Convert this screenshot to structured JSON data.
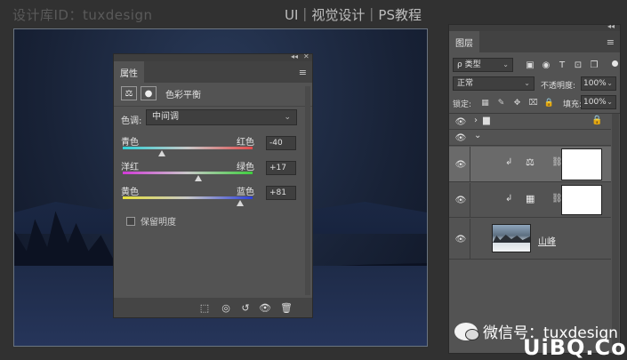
{
  "header": {
    "watermark_left": "设计库ID：tuxdesign",
    "watermark_center": "UI｜视觉设计｜PS教程"
  },
  "properties": {
    "tab_label": "属性",
    "topstrip_left": "◂◂",
    "topstrip_right": "✕",
    "menu": "≡",
    "adjustment_icon": "⚖",
    "mask_icon": "●",
    "title": "色彩平衡",
    "tone_label": "色调:",
    "tone_value": "中间调",
    "sliders": [
      {
        "left": "青色",
        "right": "红色",
        "value": "-40",
        "level": -40
      },
      {
        "left": "洋红",
        "right": "绿色",
        "value": "+17",
        "level": 17
      },
      {
        "left": "黄色",
        "right": "蓝色",
        "value": "+81",
        "level": 81
      }
    ],
    "preserve_label": "保留明度",
    "bottom_icons": [
      "clip-to-layer-icon",
      "view-previous-icon",
      "reset-icon",
      "visibility-icon",
      "trash-icon"
    ],
    "bottom_glyphs": [
      "⬚",
      "◎",
      "↺",
      "👁",
      "🗑"
    ]
  },
  "layers": {
    "tab_label": "图层",
    "topstrip_left": "◂◂",
    "menu": "≡",
    "filter_label": "ρ 类型",
    "filter_icons": [
      "▣",
      "◉",
      "T",
      "⊡",
      "❐"
    ],
    "blend_mode": "正常",
    "opacity_label": "不透明度:",
    "opacity_value": "100%",
    "lock_label": "锁定:",
    "lock_icons": [
      "▦",
      "✎",
      "✥",
      "⌧",
      "🔒"
    ],
    "fill_label": "填充:",
    "fill_value": "100%",
    "group_row": {
      "chevron": "›",
      "folder": "▆",
      "lock": "🔒"
    },
    "group_row2": {
      "chevron": "⌄"
    },
    "rows": [
      {
        "type": "color-balance",
        "clip": "↲",
        "adj": "⚖",
        "link": "⛓"
      },
      {
        "type": "levels",
        "clip": "↲",
        "adj": "▦",
        "link": "⛓"
      },
      {
        "type": "photo",
        "name": "山峰"
      }
    ]
  },
  "watermark_bottom": {
    "wechat": "微信号：tuxdesign",
    "site": "UiBQ.CoM"
  }
}
